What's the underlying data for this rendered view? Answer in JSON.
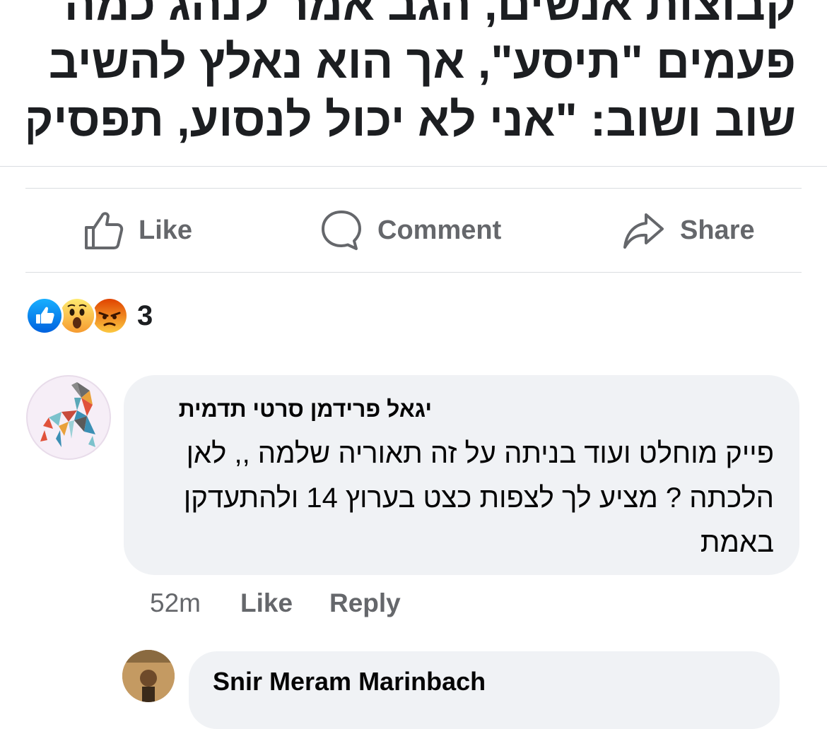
{
  "post": {
    "headline_lines": [
      "קבוצות אנשים, הגב אמר לנהג כמה",
      "פעמים \"תיסע\", אך הוא נאלץ להשיב",
      "שוב ושוב: \"אני לא יכול לנסוע, תפסיקי\""
    ]
  },
  "actions": {
    "like": "Like",
    "comment": "Comment",
    "share": "Share"
  },
  "reactions": {
    "count": "3",
    "types": [
      "like",
      "wow",
      "angry"
    ]
  },
  "comment": {
    "author": "יגאל פרידמן סרטי תדמית",
    "text_lines": [
      "פייק מוחלט  ועוד בניתה על זה תאוריה שלמה ,, לאן",
      "הלכתה ? מציע לך לצפות כצט בערוץ 14 ולהתעדקן",
      "באמת"
    ],
    "time": "52m",
    "like_label": "Like",
    "reply_label": "Reply"
  },
  "reply": {
    "author": "Snir Meram Marinbach"
  },
  "colors": {
    "secondary_text": "#65676b",
    "bubble": "#f0f2f5",
    "like_blue": "#1877f2",
    "wow_yellow": "#f7b125",
    "angry_orange": "#e9710f"
  }
}
